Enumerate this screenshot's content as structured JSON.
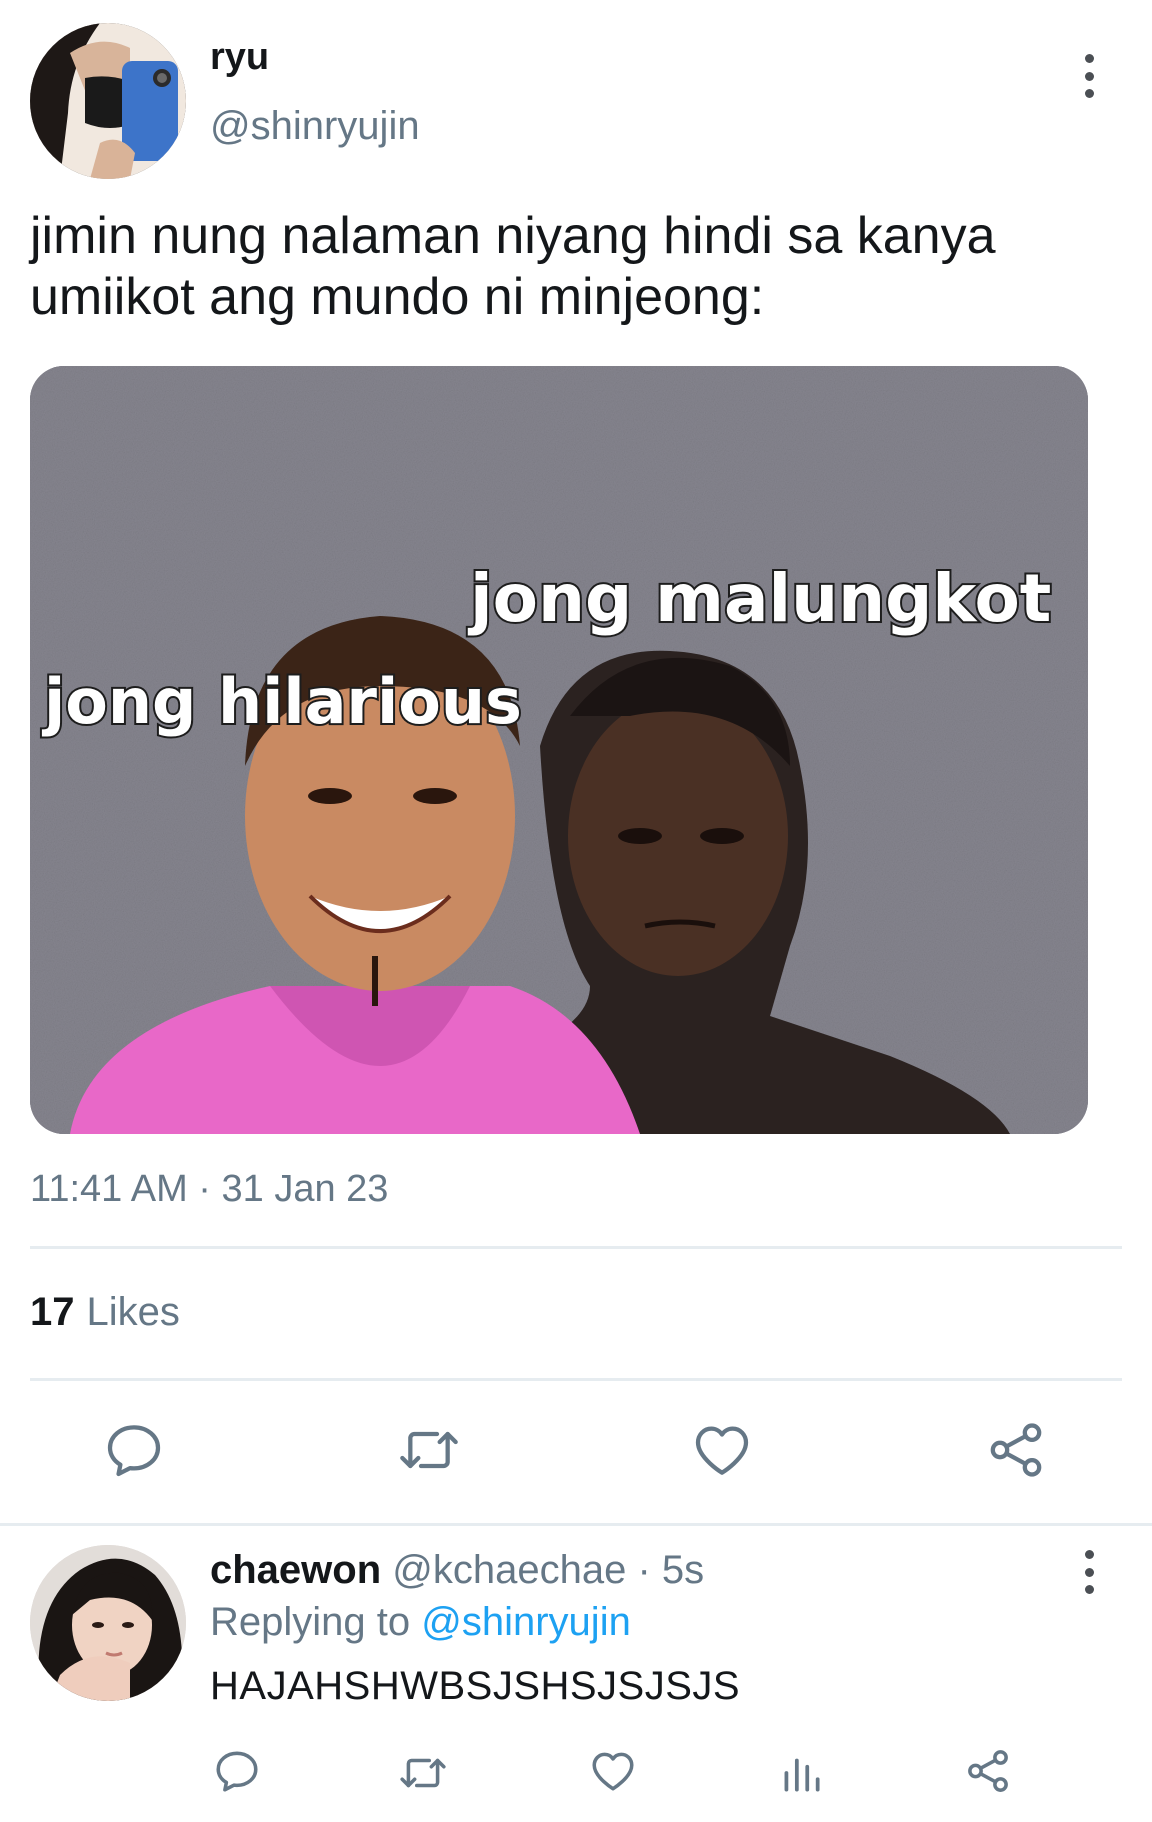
{
  "tweet": {
    "author_name": "ryu",
    "author_handle": "@shinryujin",
    "text_line1": "jimin nung nalaman niyang hindi sa kanya",
    "text_line2": "umiikot ang mundo ni minjeong:",
    "media": {
      "caption_left": "jong hilarious",
      "caption_right": "jong malungkot"
    },
    "timestamp": "11:41 AM · 31 Jan 23",
    "likes_count": "17",
    "likes_label": "Likes",
    "actions": [
      "reply-icon",
      "retweet-icon",
      "heart-icon",
      "share-icon"
    ]
  },
  "reply": {
    "author_name": "chaewon",
    "meta": "@kchaechae · 5s",
    "replying_prefix": "Replying to",
    "replying_handle": "@shinryujin",
    "text": "HAJAHSHWBSJSHSJSJSJS",
    "actions": [
      "reply-icon",
      "retweet-icon",
      "heart-icon",
      "stats-icon",
      "share-icon"
    ]
  },
  "colors": {
    "primary_text": "#14171a",
    "secondary_text": "#657786",
    "link": "#1da1f2",
    "divider": "#e6ecf0",
    "icon": "#657786"
  }
}
